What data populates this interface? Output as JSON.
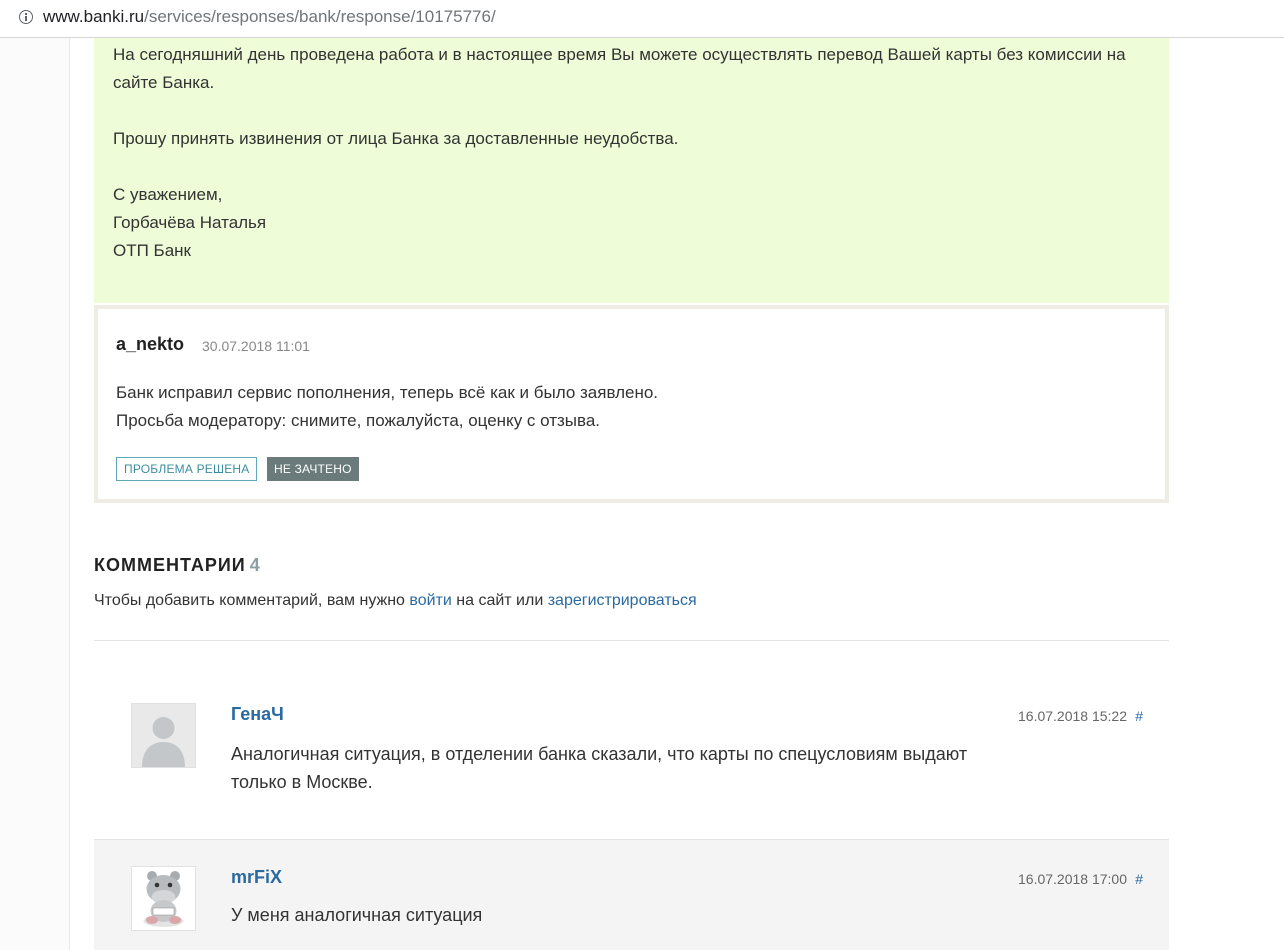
{
  "browser": {
    "url_host": "www.banki.ru",
    "url_path": "/services/responses/bank/response/10175776/"
  },
  "bank_response": {
    "paragraph1": "На сегодняшний день проведена работа и в настоящее время Вы можете осуществлять перевод Вашей карты без комиссии на сайте Банка.",
    "paragraph2": "Прошу принять извинения от лица Банка за доставленные неудобства.",
    "sign_regards": "С уважением,",
    "sign_name": "Горбачёва Наталья",
    "sign_bank": "ОТП Банк"
  },
  "author_reply": {
    "author": "a_nekto",
    "date": "30.07.2018 11:01",
    "line1": "Банк исправил сервис пополнения, теперь всё как и было заявлено.",
    "line2": "Просьба модератору: снимите, пожалуйста, оценку с отзыва.",
    "badge_solved": "ПРОБЛЕМА РЕШЕНА",
    "badge_not_counted": "НЕ ЗАЧТЕНО"
  },
  "comments_section": {
    "title": "КОММЕНТАРИИ",
    "count": "4",
    "hint_prefix": "Чтобы добавить комментарий, вам нужно ",
    "login_link": "войти",
    "hint_middle": " на сайт или ",
    "register_link": "зарегистрироваться"
  },
  "comments": [
    {
      "author": "ГенаЧ",
      "date": "16.07.2018 15:22",
      "hash": "#",
      "text_line1": "Аналогичная ситуация, в отделении банка сказали, что карты по спецусловиям выдают",
      "text_line2": "только в Москве.",
      "avatar_icon": "default-user-avatar-icon"
    },
    {
      "author": "mrFiX",
      "date": "16.07.2018 17:00",
      "hash": "#",
      "text_line1": "У меня аналогичная ситуация",
      "avatar_icon": "hippo-avatar-icon"
    }
  ],
  "colors": {
    "bank_response_bg": "#eefcd8",
    "link": "#2b6aa0",
    "badge_solved": "#3c8ea0",
    "badge_not_counted_bg": "#6b7a7b"
  }
}
